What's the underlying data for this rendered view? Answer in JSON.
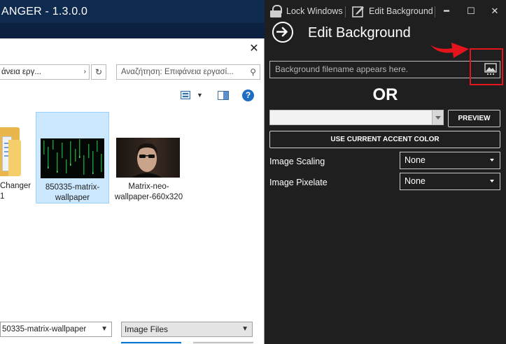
{
  "background_app": {
    "title": "ANGER - 1.3.0.0"
  },
  "file_dialog": {
    "close_glyph": "✕",
    "address_text": "άνεια εργ...",
    "address_chevron": "›",
    "search_placeholder": "Αναζήτηση: Επιφάνεια εργασί...",
    "help_glyph": "?",
    "folder_item": {
      "label": "Changer 1"
    },
    "files": [
      {
        "label": "850335-matrix-wallpaper",
        "selected": true
      },
      {
        "label": "Matrix-neo-wallpaper-660x320",
        "selected": false
      }
    ],
    "filename_value": "50335-matrix-wallpaper",
    "filetype_value": "Image Files",
    "colors": {
      "selection": "#cce8ff",
      "selection_border": "#99d1ff",
      "accent": "#0078d7"
    }
  },
  "panel": {
    "topbar": {
      "lock_label": "Lock Windows",
      "edit_label": "Edit Background",
      "minimize_glyph": "━",
      "maximize_glyph": "☐",
      "close_glyph": "✕"
    },
    "title": "Edit Background",
    "background_file": {
      "placeholder": "Background filename appears here."
    },
    "or_label": "OR",
    "preview_label": "PREVIEW",
    "accent_label": "USE CURRENT ACCENT COLOR",
    "rows": [
      {
        "label": "Image Scaling",
        "value": "None"
      },
      {
        "label": "Image Pixelate",
        "value": "None"
      }
    ],
    "colors": {
      "background": "#1f1f1f",
      "annotation": "#e3141b"
    }
  }
}
